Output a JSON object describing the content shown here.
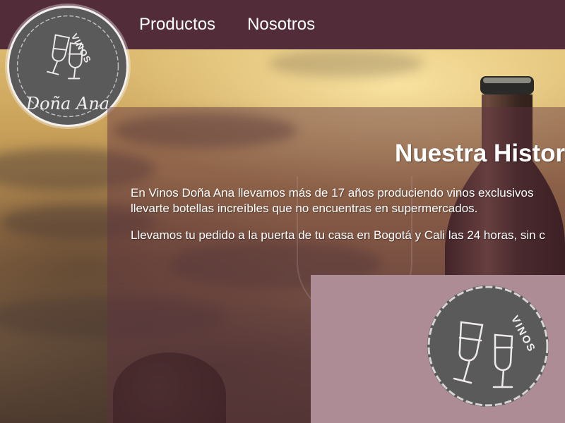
{
  "nav": {
    "items": [
      {
        "label": "Productos"
      },
      {
        "label": "Nosotros"
      }
    ]
  },
  "logo": {
    "brand_small": "VINOS",
    "brand_name": "Doña Ana"
  },
  "main": {
    "title": "Nuestra Historia",
    "paragraphs": [
      "En Vinos Doña Ana llevamos más de 17 años produciendo vinos exclusivos",
      "llevarte botellas increíbles que no encuentras en supermercados.",
      "Llevamos tu pedido a la puerta de tu casa en Bogotá y Cali las 24 horas, sin c"
    ]
  },
  "feature_logo": {
    "brand_small": "VINOS"
  },
  "colors": {
    "navbar": "#522c39",
    "panel": "#ad8c96",
    "logo_fill": "#5a5a5a"
  }
}
